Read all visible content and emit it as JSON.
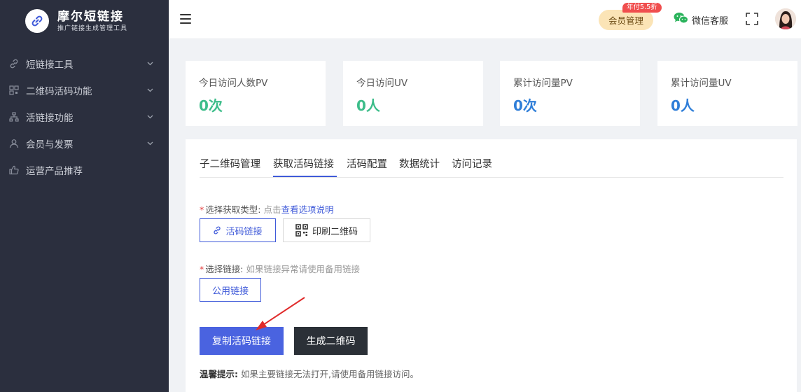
{
  "brand": {
    "title": "摩尔短链接",
    "subtitle": "推广链接生成管理工具"
  },
  "sidebar": {
    "items": [
      {
        "label": "短链接工具",
        "icon": "link-icon",
        "expandable": true
      },
      {
        "label": "二维码活码功能",
        "icon": "qrcode-icon",
        "expandable": true
      },
      {
        "label": "活链接功能",
        "icon": "sitemap-icon",
        "expandable": true
      },
      {
        "label": "会员与发票",
        "icon": "user-icon",
        "expandable": true
      },
      {
        "label": "运营产品推荐",
        "icon": "thumbs-up-icon",
        "expandable": false
      }
    ]
  },
  "header": {
    "vip_label": "会员管理",
    "vip_badge": "年付5.5折",
    "wechat_label": "微信客服"
  },
  "stats": [
    {
      "label": "今日访问人数PV",
      "value": "0次",
      "color": "#3dbd8a"
    },
    {
      "label": "今日访问UV",
      "value": "0人",
      "color": "#3dbd8a"
    },
    {
      "label": "累计访问量PV",
      "value": "0次",
      "color": "#2f7ed8"
    },
    {
      "label": "累计访问量UV",
      "value": "0人",
      "color": "#2f7ed8"
    }
  ],
  "tabs": [
    {
      "label": "子二维码管理",
      "active": false
    },
    {
      "label": "获取活码链接",
      "active": true
    },
    {
      "label": "活码配置",
      "active": false
    },
    {
      "label": "数据统计",
      "active": false
    },
    {
      "label": "访问记录",
      "active": false
    }
  ],
  "form": {
    "type_label": "选择获取类型:",
    "type_hint": "点击",
    "type_link": "查看选项说明",
    "type_options": [
      {
        "label": "活码链接",
        "icon": "link-icon",
        "selected": true
      },
      {
        "label": "印刷二维码",
        "icon": "qrcode-icon",
        "selected": false
      }
    ],
    "link_label": "选择链接:",
    "link_hint": "如果链接异常请使用备用链接",
    "link_options": [
      {
        "label": "公用链接",
        "selected": true
      }
    ],
    "copy_button": "复制活码链接",
    "qrcode_button": "生成二维码",
    "tip_label": "温馨提示:",
    "tip_text": "如果主要链接无法打开,请使用备用链接访问。"
  },
  "colors": {
    "accent": "#4a63e0",
    "sidebar_bg": "#2b2f3e",
    "stat_green": "#3dbd8a",
    "stat_blue": "#2f7ed8",
    "required": "#e23d3d",
    "annotation_arrow": "#e02b2b"
  }
}
